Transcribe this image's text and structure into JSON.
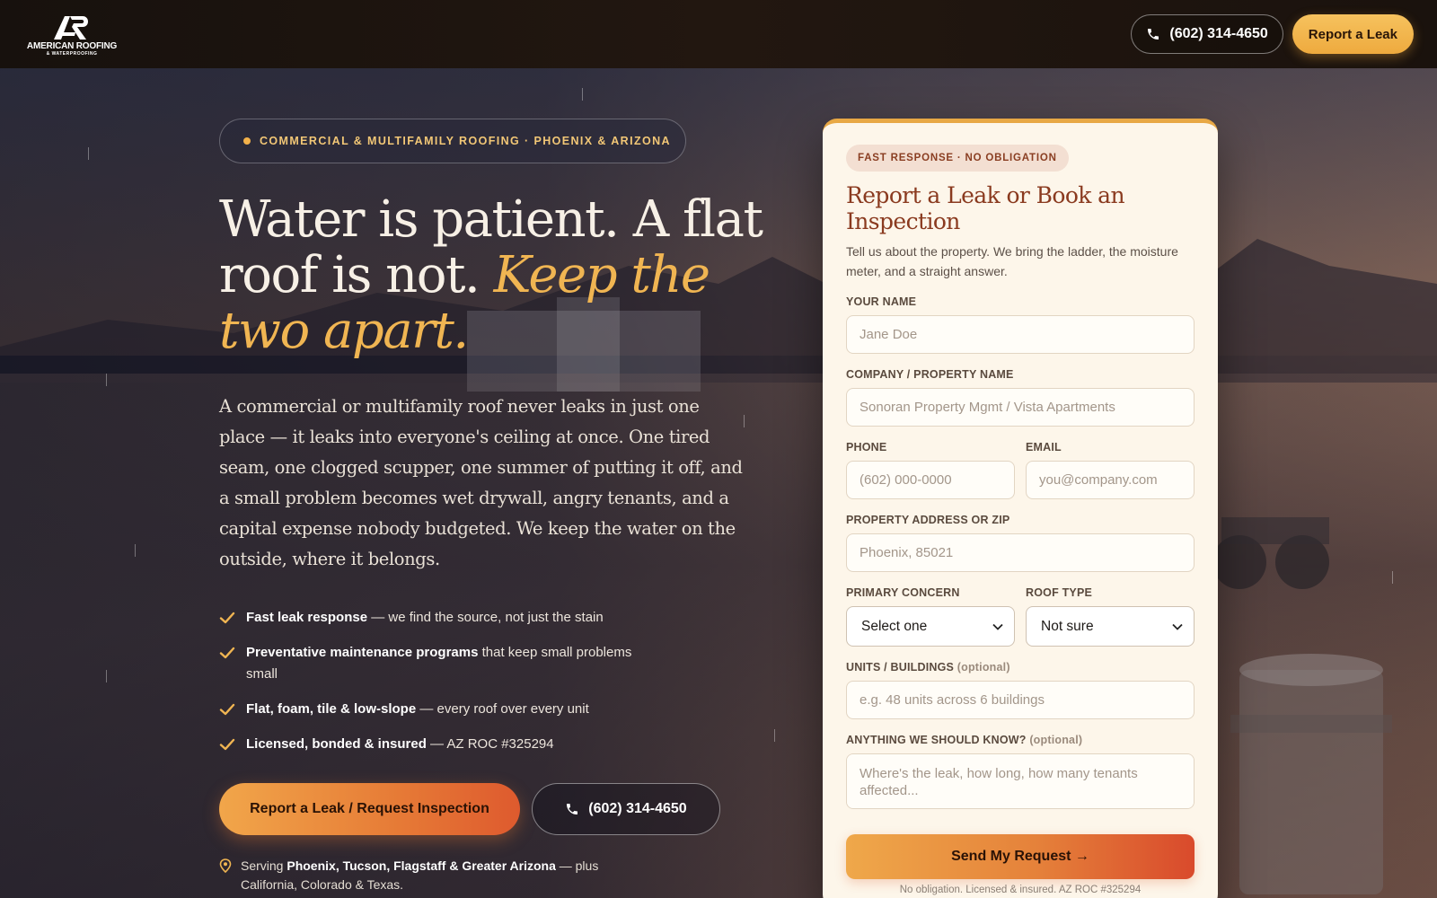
{
  "brand": {
    "name_line1": "AMERICAN ROOFING",
    "name_line2": "& WATERPROOFING"
  },
  "header": {
    "phone": "(602) 314-4650",
    "cta": "Report a Leak"
  },
  "hero": {
    "eyebrow": "COMMERCIAL & MULTIFAMILY ROOFING · PHOENIX & ARIZONA",
    "headline_plain": "Water is patient. A flat roof is not.",
    "headline_emphasis": "Keep the two apart.",
    "lead": "A commercial or multifamily roof never leaks in just one place — it leaks into everyone's ceiling at once. One tired seam, one clogged scupper, one summer of putting it off, and a small problem becomes wet drywall, angry tenants, and a capital expense nobody budgeted. We keep the water on the outside, where it belongs.",
    "features": [
      {
        "bold": "Fast leak response",
        "rest": " — we find the source, not just the stain"
      },
      {
        "bold": "Preventative maintenance programs",
        "rest": " that keep small problems small"
      },
      {
        "bold": "Flat, foam, tile & low-slope",
        "rest": " — every roof over every unit"
      },
      {
        "bold": "Licensed, bonded & insured",
        "rest": " — AZ ROC #325294"
      }
    ],
    "cta_primary": "Report a Leak / Request Inspection",
    "cta_phone": "(602) 314-4650",
    "serving_prefix": "Serving ",
    "serving_bold": "Phoenix, Tucson, Flagstaff & Greater Arizona",
    "serving_rest": " — plus California, Colorado & Texas."
  },
  "form": {
    "badge": "FAST RESPONSE · NO OBLIGATION",
    "title": "Report a Leak or Book an Inspection",
    "subtitle": "Tell us about the property. We bring the ladder, the moisture meter, and a straight answer.",
    "name_label": "YOUR NAME",
    "name_placeholder": "Jane Doe",
    "company_label": "COMPANY / PROPERTY NAME",
    "company_placeholder": "Sonoran Property Mgmt / Vista Apartments",
    "phone_label": "PHONE",
    "phone_placeholder": "(602) 000-0000",
    "email_label": "EMAIL",
    "email_placeholder": "you@company.com",
    "address_label": "PROPERTY ADDRESS OR ZIP",
    "address_placeholder": "Phoenix, 85021",
    "concern_label": "PRIMARY CONCERN",
    "concern_value": "Select one",
    "rooftype_label": "ROOF TYPE",
    "rooftype_value": "Not sure",
    "units_label": "UNITS / BUILDINGS",
    "units_optional": "(optional)",
    "units_placeholder": "e.g. 48 units across 6 buildings",
    "notes_label": "ANYTHING WE SHOULD KNOW?",
    "notes_optional": "(optional)",
    "notes_placeholder": "Where's the leak, how long, how many tenants affected...",
    "submit": "Send My Request →",
    "fineprint": "No obligation. Licensed & insured. AZ ROC #325294"
  },
  "colors": {
    "accent": "#f0b552",
    "cta_gradient_start": "#f1a64a",
    "cta_gradient_end": "#de5a2e",
    "card_bg": "#fdf6ea",
    "title_rust": "#8a3a1f"
  },
  "icons": [
    "phone-icon",
    "check-icon",
    "map-pin-icon",
    "chevron-down-icon"
  ]
}
